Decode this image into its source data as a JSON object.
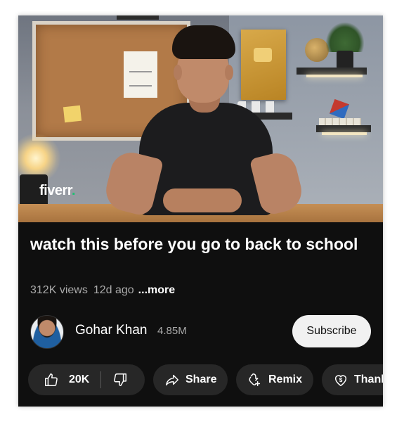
{
  "video": {
    "brand_logo": "fiverr",
    "brand_logo_dot": "."
  },
  "title": "watch this before you go to back to school",
  "meta": {
    "views": "312K views",
    "age": "12d ago",
    "more": "...more"
  },
  "channel": {
    "name": "Gohar Khan",
    "subscribers": "4.85M",
    "subscribe_label": "Subscribe",
    "avatar_icon": "channel-avatar"
  },
  "actions": {
    "like_count": "20K",
    "like_icon": "thumbs-up-icon",
    "dislike_icon": "thumbs-down-icon",
    "share_label": "Share",
    "share_icon": "share-arrow-icon",
    "remix_label": "Remix",
    "remix_icon": "remix-icon",
    "thanks_label": "Thank",
    "thanks_icon": "thanks-heart-dollar-icon"
  },
  "colors": {
    "background": "#0f0f0f",
    "pill": "#272727",
    "subscribe_bg": "#f1f1f1",
    "brand_green": "#1dbf73"
  }
}
